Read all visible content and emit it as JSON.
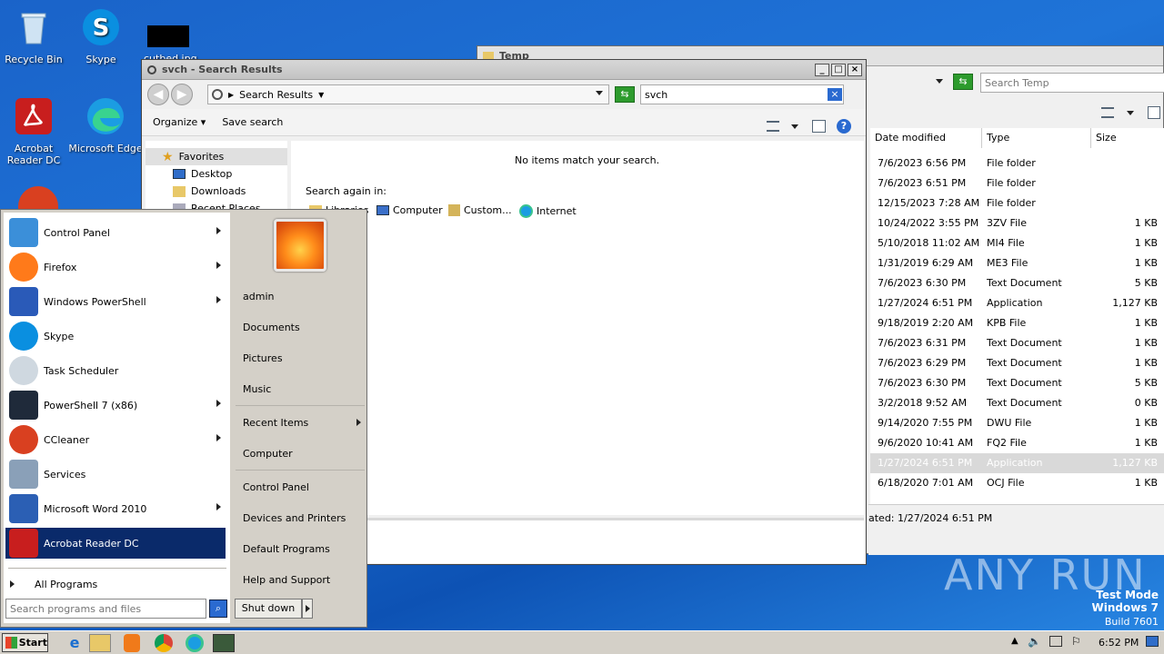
{
  "desktop": {
    "icons": [
      {
        "label": "Recycle Bin"
      },
      {
        "label": "Skype"
      },
      {
        "label": "Acrobat Reader DC"
      },
      {
        "label": "Microsoft Edge"
      }
    ],
    "partial_file_label": "cutbed.jpg"
  },
  "temp_window": {
    "title": "Temp",
    "search_placeholder": "Search Temp",
    "columns": {
      "date": "Date modified",
      "type": "Type",
      "size": "Size"
    },
    "rows": [
      {
        "date": "7/6/2023 6:56 PM",
        "type": "File folder",
        "size": ""
      },
      {
        "date": "7/6/2023 6:51 PM",
        "type": "File folder",
        "size": ""
      },
      {
        "date": "12/15/2023 7:28 AM",
        "type": "File folder",
        "size": ""
      },
      {
        "date": "10/24/2022 3:55 PM",
        "type": "3ZV File",
        "size": "1 KB"
      },
      {
        "date": "5/10/2018 11:02 AM",
        "type": "MI4 File",
        "size": "1 KB"
      },
      {
        "date": "1/31/2019 6:29 AM",
        "type": "ME3 File",
        "size": "1 KB"
      },
      {
        "date": "7/6/2023 6:30 PM",
        "type": "Text Document",
        "size": "5 KB"
      },
      {
        "date": "1/27/2024 6:51 PM",
        "type": "Application",
        "size": "1,127 KB"
      },
      {
        "date": "9/18/2019 2:20 AM",
        "type": "KPB File",
        "size": "1 KB"
      },
      {
        "date": "7/6/2023 6:31 PM",
        "type": "Text Document",
        "size": "1 KB"
      },
      {
        "date": "7/6/2023 6:29 PM",
        "type": "Text Document",
        "size": "1 KB"
      },
      {
        "date": "7/6/2023 6:30 PM",
        "type": "Text Document",
        "size": "5 KB"
      },
      {
        "date": "3/2/2018 9:52 AM",
        "type": "Text Document",
        "size": "0 KB"
      },
      {
        "date": "9/14/2020 7:55 PM",
        "type": "DWU File",
        "size": "1 KB"
      },
      {
        "date": "9/6/2020 10:41 AM",
        "type": "FQ2 File",
        "size": "1 KB"
      },
      {
        "date": "1/27/2024 6:51 PM",
        "type": "Application",
        "size": "1,127 KB"
      },
      {
        "date": "6/18/2020 7:01 AM",
        "type": "OCJ File",
        "size": "1 KB"
      }
    ],
    "status_text": "ated: 1/27/2024 6:51 PM"
  },
  "search_window": {
    "title": "svch - Search Results",
    "breadcrumb": "Search Results",
    "search_value": "svch",
    "organize_label": "Organize",
    "save_search_label": "Save search",
    "nav": {
      "favorites": "Favorites",
      "desktop": "Desktop",
      "downloads": "Downloads",
      "recent_places": "Recent Places"
    },
    "empty_message": "No items match your search.",
    "search_again_label": "Search again in:",
    "search_again_options": {
      "libraries": "Libraries",
      "computer": "Computer",
      "custom": "Custom...",
      "internet": "Internet"
    }
  },
  "start_menu": {
    "programs": [
      {
        "label": "Control Panel"
      },
      {
        "label": "Firefox"
      },
      {
        "label": "Windows PowerShell"
      },
      {
        "label": "Skype"
      },
      {
        "label": "Task Scheduler"
      },
      {
        "label": "PowerShell 7 (x86)"
      },
      {
        "label": "CCleaner"
      },
      {
        "label": "Services"
      },
      {
        "label": "Microsoft Word 2010"
      },
      {
        "label": "Acrobat Reader DC"
      }
    ],
    "all_programs": "All Programs",
    "search_placeholder": "Search programs and files",
    "right_items": {
      "admin": "admin",
      "documents": "Documents",
      "pictures": "Pictures",
      "music": "Music",
      "recent_items": "Recent Items",
      "computer": "Computer",
      "control_panel": "Control Panel",
      "devices_printers": "Devices and Printers",
      "default_programs": "Default Programs",
      "help_support": "Help and Support"
    },
    "shutdown_label": "Shut down"
  },
  "taskbar": {
    "start_label": "Start",
    "clock": "6:52 PM"
  },
  "watermark": {
    "brand": "ANY RUN",
    "test_mode": "Test Mode",
    "os": "Windows 7",
    "build": "Build 7601"
  }
}
